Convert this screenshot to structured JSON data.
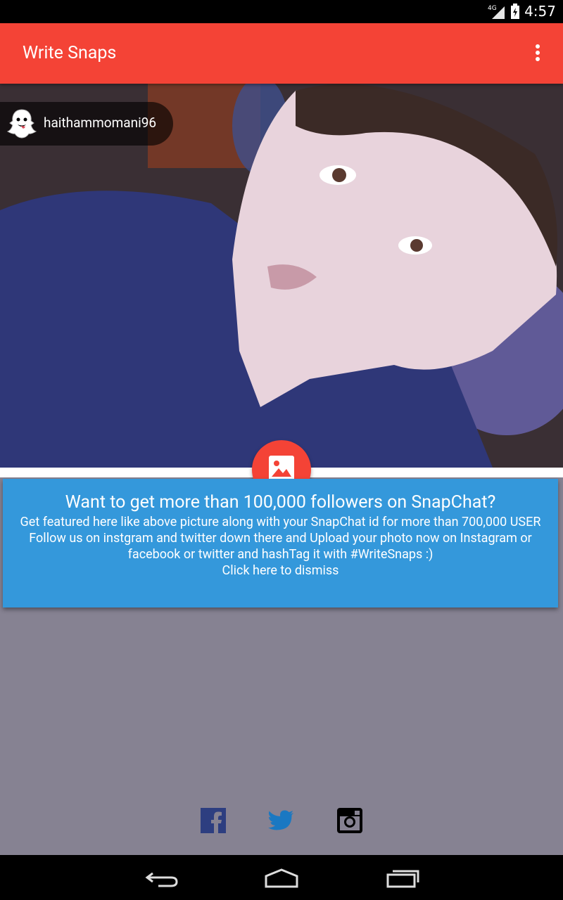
{
  "status_bar": {
    "network": "4G",
    "time": "4:57"
  },
  "app_bar": {
    "title": "Write Snaps",
    "menu_icon": "overflow-menu-icon"
  },
  "featured": {
    "username": "haithammomani96",
    "badge_icon": "snapchat-ghost-icon"
  },
  "fab": {
    "icon": "image-icon",
    "color": "#f44336"
  },
  "banner": {
    "title": "Want to get more than 100,000 followers on SnapChat?",
    "line1": "Get featured here like above picture along with your SnapChat id for more than 700,000 USER",
    "line2": "Follow us on instgram and twitter down there and Upload your photo now on Instagram or facebook or twitter and hashTag it with #WriteSnaps :)",
    "dismiss": "Click here to dismiss",
    "color": "#3498db"
  },
  "social": [
    {
      "name": "facebook-icon"
    },
    {
      "name": "twitter-icon"
    },
    {
      "name": "instagram-icon"
    }
  ],
  "nav": [
    "back-icon",
    "home-icon",
    "recent-apps-icon"
  ],
  "colors": {
    "accent": "#f44336",
    "background": "#868292"
  }
}
